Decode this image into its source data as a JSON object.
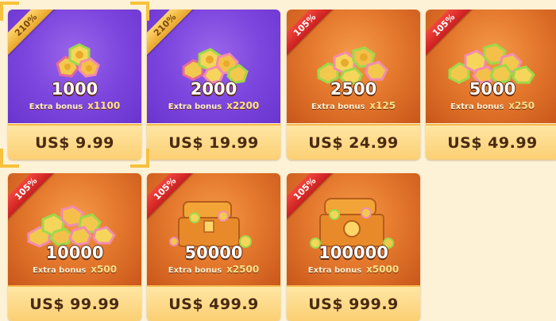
{
  "store": {
    "currency_label": "US$",
    "selected_index": 0,
    "colors": {
      "background": "#fdf2d6",
      "card_purple": "#7d46de",
      "card_orange": "#e57a2e",
      "price_bar": "#fbcf73",
      "ribbon_gold": "#e8a52a",
      "ribbon_red": "#d02a25",
      "select_corner": "#f6c13c"
    },
    "packs": [
      {
        "ribbon": "210%",
        "ribbon_color": "gold",
        "theme": "purple",
        "art": "coin-pile-icon",
        "amount": "1000",
        "bonus_label": "Extra bonus",
        "bonus_mult": "x1100",
        "price": "US$ 9.99"
      },
      {
        "ribbon": "210%",
        "ribbon_color": "gold",
        "theme": "purple",
        "art": "coin-pile-icon",
        "amount": "2000",
        "bonus_label": "Extra bonus",
        "bonus_mult": "x2200",
        "price": "US$ 19.99"
      },
      {
        "ribbon": "105%",
        "ribbon_color": "red",
        "theme": "orange",
        "art": "coin-pile-icon",
        "amount": "2500",
        "bonus_label": "Extra bonus",
        "bonus_mult": "x125",
        "price": "US$ 24.99"
      },
      {
        "ribbon": "105%",
        "ribbon_color": "red",
        "theme": "orange",
        "art": "coin-pile-icon",
        "amount": "5000",
        "bonus_label": "Extra bonus",
        "bonus_mult": "x250",
        "price": "US$ 49.99"
      },
      {
        "ribbon": "105%",
        "ribbon_color": "red",
        "theme": "orange",
        "art": "coin-pile-icon",
        "amount": "10000",
        "bonus_label": "Extra bonus",
        "bonus_mult": "x500",
        "price": "US$ 99.99"
      },
      {
        "ribbon": "105%",
        "ribbon_color": "red",
        "theme": "orange",
        "art": "treasure-chest-icon",
        "amount": "50000",
        "bonus_label": "Extra bonus",
        "bonus_mult": "x2500",
        "price": "US$ 499.9"
      },
      {
        "ribbon": "105%",
        "ribbon_color": "red",
        "theme": "orange",
        "art": "treasure-chest-icon",
        "amount": "100000",
        "bonus_label": "Extra bonus",
        "bonus_mult": "x5000",
        "price": "US$ 999.9"
      }
    ]
  }
}
